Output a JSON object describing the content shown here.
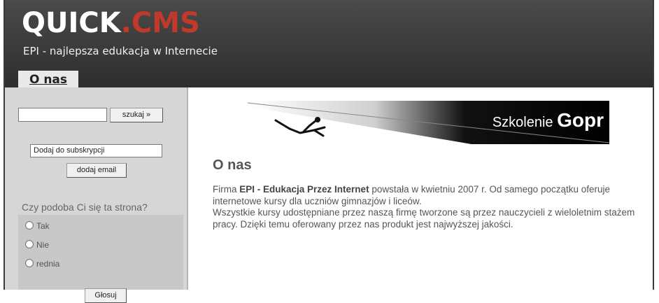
{
  "header": {
    "logo_main": "QUICK",
    "logo_dot": ".",
    "logo_suffix": "CMS",
    "slogan": "EPI - najlepsza edukacja w Internecie",
    "tab": "O nas"
  },
  "sidebar": {
    "search_button": "szukaj »",
    "subscription_value": "Dodaj do subskrypcji",
    "subscribe_button": "dodaj email",
    "poll": {
      "question": "Czy podoba Ci się ta strona?",
      "options": [
        "Tak",
        "Nie",
        "rednia"
      ],
      "vote_button": "Głosuj"
    }
  },
  "banner": {
    "text_prefix": "Szkolenie",
    "text_bold": "Gopr"
  },
  "content": {
    "title": "O nas",
    "p1_before": "Firma ",
    "p1_bold": "EPI - Edukacja Przez Internet",
    "p1_after": " powstała w kwietniu 2007 r. Od samego początku oferuje internetowe kursy dla uczniów gimnazjów i liceów.",
    "p2": "Wszystkie kursy udostępniane przez naszą firmę tworzone są przez nauczycieli z wieloletnim stażem pracy. Dzięki temu oferowany przez nas produkt jest najwyższej jakości."
  }
}
